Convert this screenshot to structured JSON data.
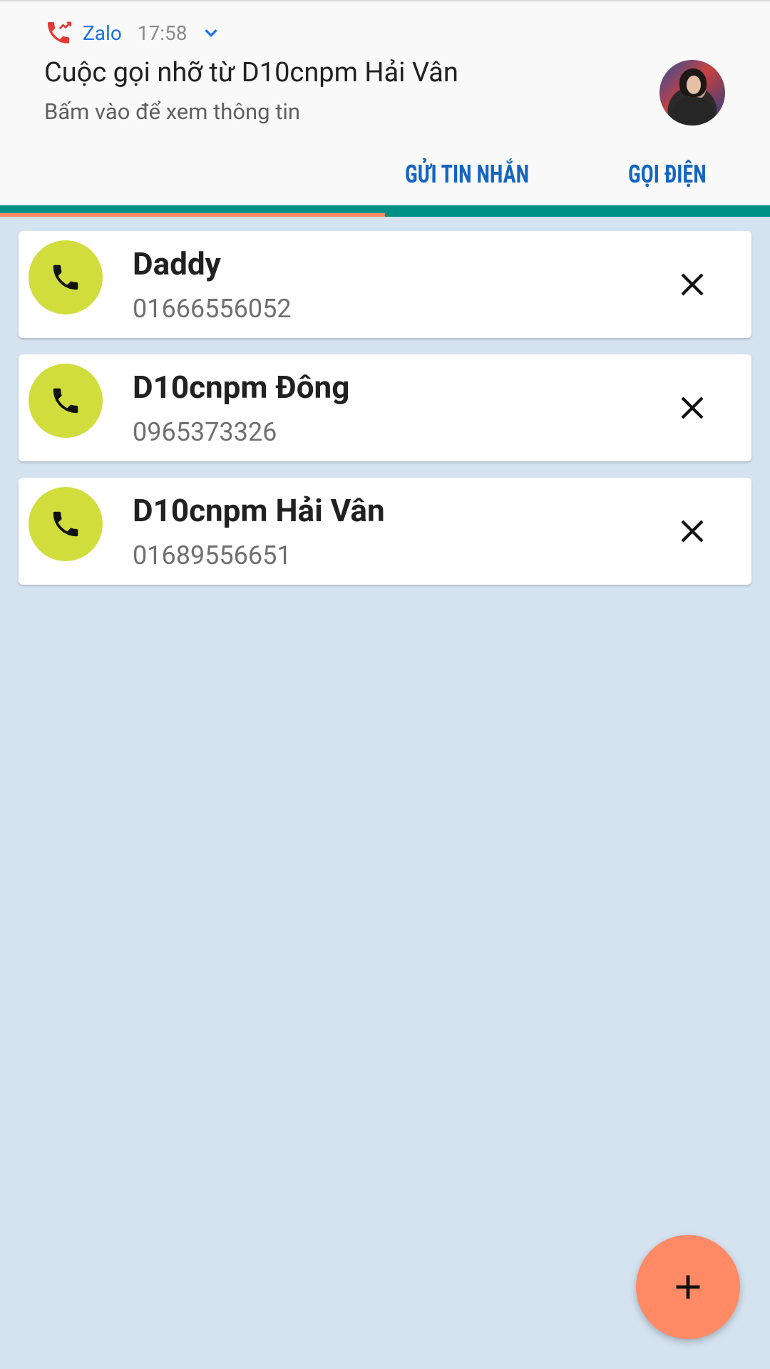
{
  "notification": {
    "app_name": "Zalo",
    "time": "17:58",
    "title": "Cuộc gọi nhỡ từ D10cnpm Hải Vân",
    "subtitle": "Bấm vào để xem thông tin",
    "actions": {
      "send_message": "GỬI TIN NHẮN",
      "call": "GỌI ĐIỆN"
    },
    "icons": {
      "app": "missed-call-icon",
      "expand": "chevron-down-icon"
    },
    "colors": {
      "accent": "#1565c0",
      "missed_call": "#e53935"
    }
  },
  "progress": {
    "fraction": 0.5,
    "track_color": "#019086",
    "fill_color": "#ff8a65"
  },
  "contacts": [
    {
      "name": "Daddy",
      "number": "01666556052"
    },
    {
      "name": "D10cnpm Đông",
      "number": "0965373326"
    },
    {
      "name": "D10cnpm Hải Vân",
      "number": "01689556651"
    }
  ],
  "contact_icons": {
    "call": "phone-icon",
    "remove": "close-icon"
  },
  "fab": {
    "icon": "plus-icon",
    "color": "#ff8a65"
  },
  "theme": {
    "background": "#d5e3f1",
    "phone_circle": "#d0dd3c"
  }
}
